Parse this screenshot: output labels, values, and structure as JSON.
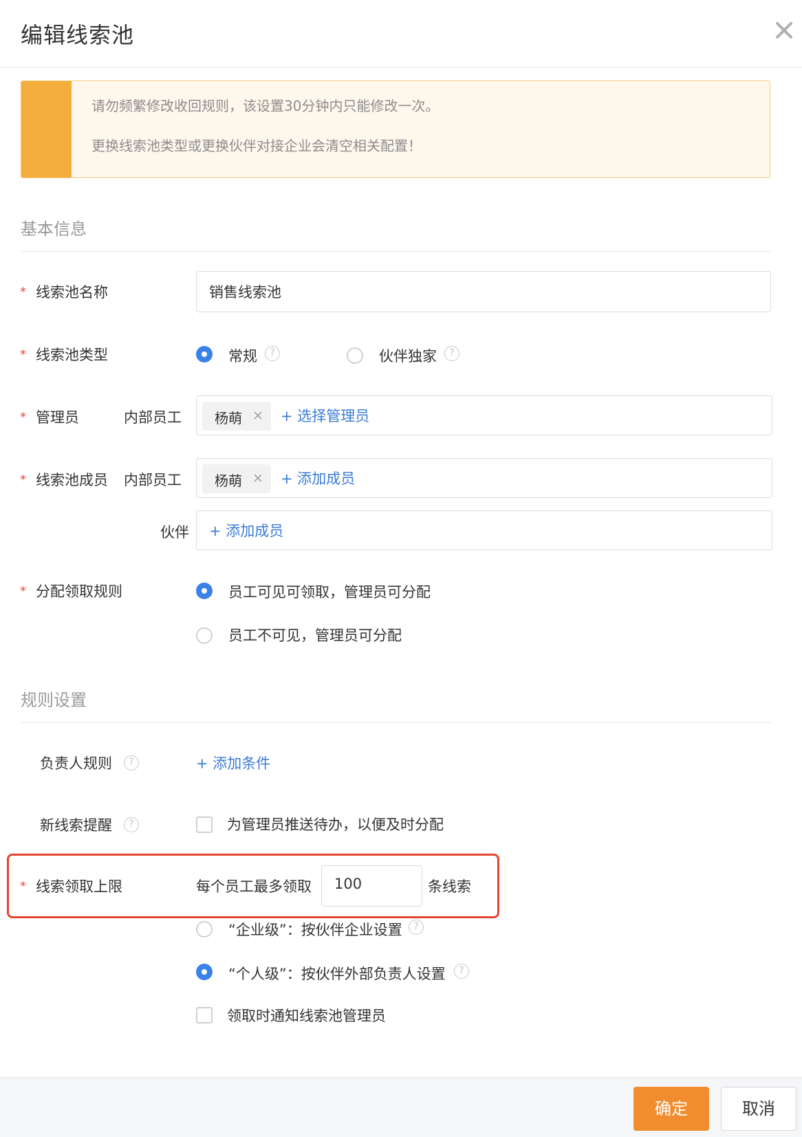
{
  "dialog": {
    "title": "编辑线索池",
    "close_icon": "close-icon"
  },
  "notice": {
    "lines": [
      "请勿频繁修改收回规则，该设置30分钟内只能修改一次。",
      "更换线索池类型或更换伙伴对接企业会清空相关配置！"
    ],
    "accent_color": "#f2ad3c"
  },
  "basic": {
    "section_title": "基本信息",
    "required_mark": "*",
    "name": {
      "label": "线索池名称",
      "value": "销售线索池"
    },
    "type": {
      "label": "线索池类型",
      "options": [
        {
          "label": "常规",
          "selected": true
        },
        {
          "label": "伙伴独家",
          "selected": false
        }
      ]
    },
    "admin": {
      "label": "管理员",
      "sublabel": "内部员工",
      "tags": [
        "杨萌"
      ],
      "add_link": "+ 选择管理员"
    },
    "members": {
      "label": "线索池成员",
      "internal_sublabel": "内部员工",
      "internal_tags": [
        "杨萌"
      ],
      "internal_add": "+ 添加成员",
      "partner_sublabel": "伙伴",
      "partner_add": "+ 添加成员"
    },
    "assign": {
      "label": "分配领取规则",
      "options": [
        {
          "label": "员工可见可领取，管理员可分配",
          "selected": true
        },
        {
          "label": "员工不可见，管理员可分配",
          "selected": false
        }
      ]
    }
  },
  "rules": {
    "section_title": "规则设置",
    "owner_rule": {
      "label": "负责人规则",
      "add_link": "+ 添加条件"
    },
    "new_lead_reminder": {
      "label": "新线索提醒",
      "checkbox_label": "为管理员推送待办，以便及时分配",
      "checked": false
    },
    "claim_limit": {
      "label": "线索领取上限",
      "prefix": "每个员工最多领取",
      "value": "100",
      "suffix": "条线索",
      "options": [
        {
          "label": "“企业级”：按伙伴企业设置",
          "selected": false
        },
        {
          "label": "“个人级”：按伙伴外部负责人设置",
          "selected": true
        }
      ],
      "notify_label": "领取时通知线索池管理员",
      "notify_checked": false
    }
  },
  "footer": {
    "ok_label": "确定",
    "cancel_label": "取消",
    "ok_color": "#f28d2f"
  },
  "help_glyph": "?"
}
